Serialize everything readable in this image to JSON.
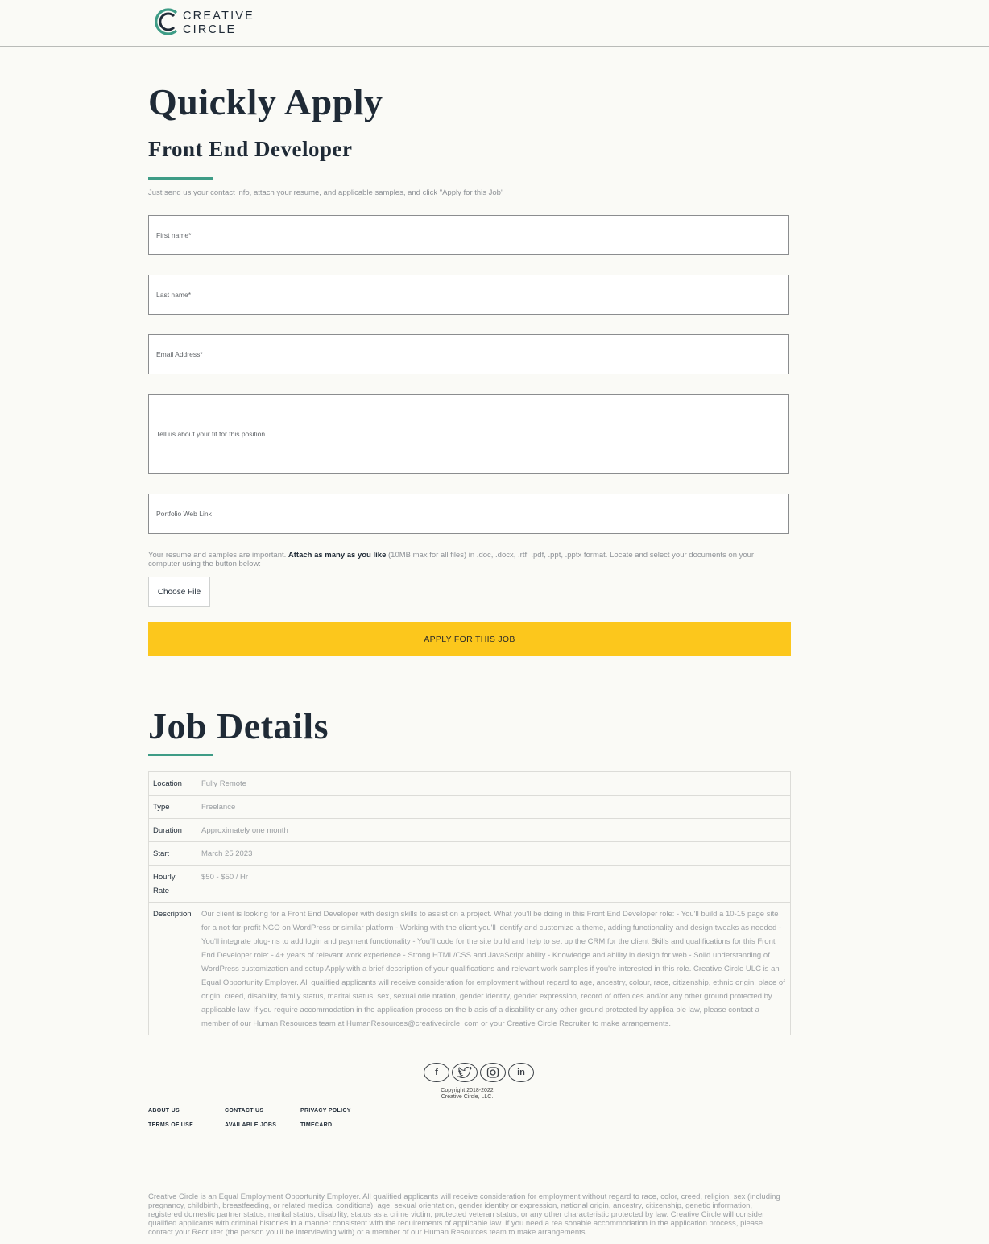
{
  "brand": {
    "line1": "CREATIVE",
    "line2": "CIRCLE",
    "accent_color": "#3e9c86",
    "logo_mark_color": "#1f5c4e"
  },
  "apply": {
    "heading": "Quickly Apply",
    "job_title": "Front End Developer",
    "intro": "Just send us your contact info, attach your resume, and applicable samples, and click \"Apply for this Job\""
  },
  "form": {
    "first_name_placeholder": "First name*",
    "last_name_placeholder": "Last name*",
    "email_placeholder": "Email Address*",
    "fit_placeholder": "Tell us about your fit for this position",
    "portfolio_placeholder": "Portfolio Web Link",
    "upload_note_before": "Your resume and samples are important.",
    "upload_note_bold": "Attach as many as you like",
    "upload_note_after": "(10MB max for all files) in .doc, .docx, .rtf, .pdf, .ppt, .pptx format. Locate and select your documents on your computer using the button below:",
    "choose_file_label": "Choose File",
    "apply_button_label": "APPLY FOR THIS JOB",
    "apply_button_color": "#fcc71c"
  },
  "details": {
    "heading": "Job Details",
    "rows": [
      {
        "label": "Location",
        "value": "Fully Remote"
      },
      {
        "label": "Type",
        "value": "Freelance"
      },
      {
        "label": "Duration",
        "value": "Approximately one month"
      },
      {
        "label": "Start",
        "value": "March 25 2023"
      },
      {
        "label": "Hourly Rate",
        "value": "$50 - $50 / Hr"
      },
      {
        "label": "Description",
        "value": "Our client is looking for a Front End Developer with design skills to assist on a project. What you'll be doing in this Front End Developer role: - You'll build a 10-15 page site for a not-for-profit NGO on WordPress or similar platform - Working with the client you'll identify and customize a theme, adding functionality and design tweaks as needed - You'll integrate plug-ins to add login and payment functionality - You'll code for the site build and help to set up the CRM for the client Skills and qualifications for this Front End Developer role: - 4+ years of relevant work experience - Strong HTML/CSS and JavaScript ability - Knowledge and ability in design for web - Solid understanding of WordPress customization and setup Apply with a brief description of your qualifications and relevant work samples if you're interested in this role. Creative Circle ULC is an Equal Opportunity Employer. All qualified applicants will receive consideration for employment without regard to age, ancestry, colour, race, citizenship, ethnic origin, place of origin, creed, disability, family status, marital status, sex, sexual orie ntation, gender identity, gender expression, record of offen ces and/or any other ground protected by applicable law. If you require accommodation in the application process on the b asis of a disability or any other ground protected by applica ble law, please contact a member of our Human Resources team at HumanResources@creativecircle. com or your Creative Circle Recruiter to make arrangements."
      }
    ]
  },
  "footer": {
    "social_icons": [
      "facebook-icon",
      "twitter-icon",
      "instagram-icon",
      "linkedin-icon"
    ],
    "copyright_line1": "Copyright 2018-2022",
    "copyright_line2": "Creative Circle, LLC.",
    "links": {
      "about": "ABOUT US",
      "contact": "CONTACT US",
      "privacy": "PRIVACY POLICY",
      "terms": "TERMS OF USE",
      "jobs": "AVAILABLE JOBS",
      "timecard": "TIMECARD"
    },
    "eeo": "Creative Circle is an Equal Employment Opportunity Employer. All qualified applicants will receive consideration for employment without regard to race, color, creed, religion, sex (including pregnancy, childbirth, breastfeeding, or related medical conditions), age, sexual orientation, gender identity or expression, national origin, ancestry, citizenship, genetic information, registered domestic partner status, marital status, disability, status as a crime victim, protected veteran status, or any other characteristic protected by law. Creative Circle will consider qualified applicants with criminal histories in a manner consistent with the requirements of applicable law. If you need a rea sonable accommodation in the application process, please contact your Recruiter (the person you'll be interviewing with) or a member of our Human Resources team to make arrangements."
  }
}
